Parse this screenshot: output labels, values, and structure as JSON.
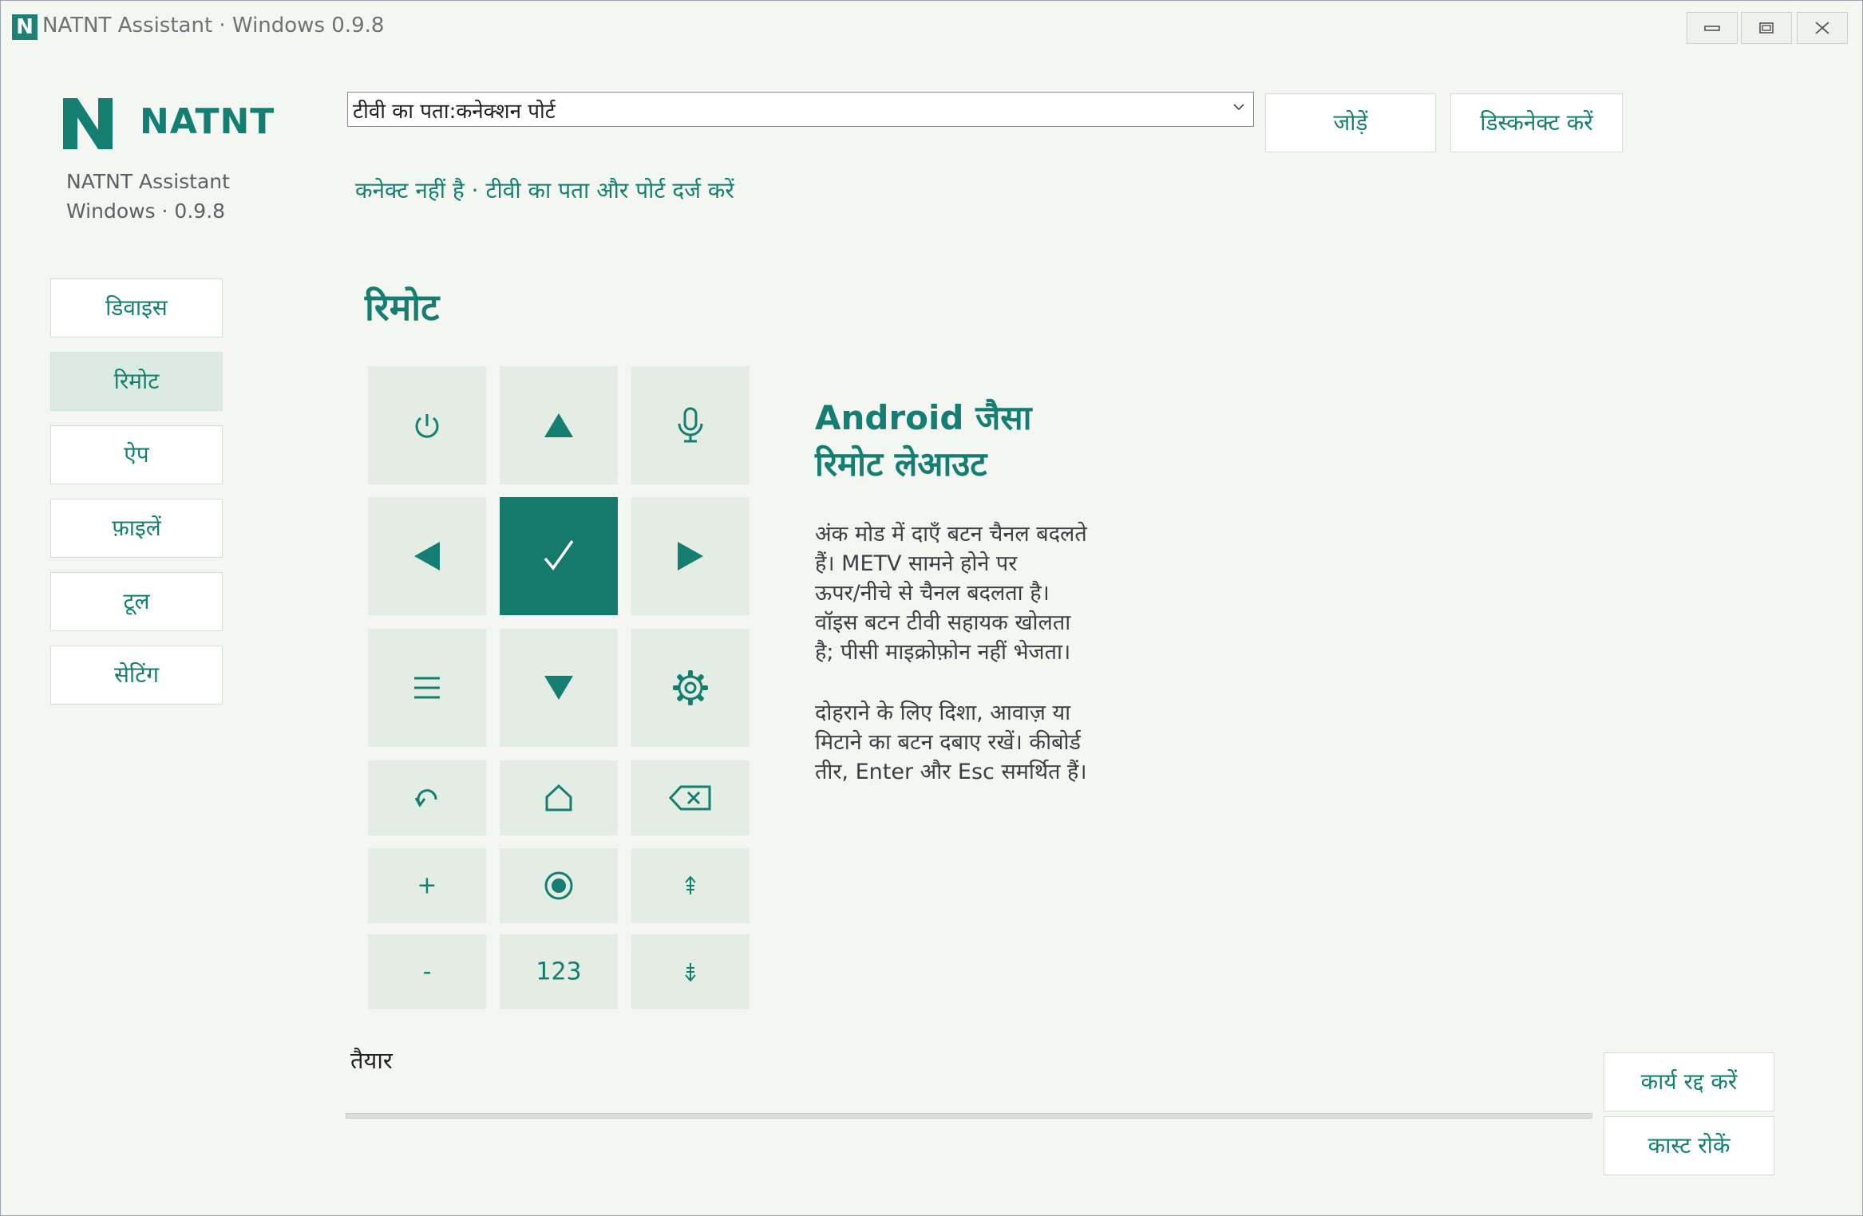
{
  "window": {
    "title": "NATNT Assistant · Windows 0.9.8",
    "app_icon_letter": "N"
  },
  "sidebar": {
    "brand": "NATNT",
    "app_name": "NATNT Assistant",
    "version": "Windows · 0.9.8",
    "items": [
      {
        "label": "डिवाइस",
        "active": false
      },
      {
        "label": "रिमोट",
        "active": true
      },
      {
        "label": "ऐप",
        "active": false
      },
      {
        "label": "फ़ाइलें",
        "active": false
      },
      {
        "label": "टूल",
        "active": false
      },
      {
        "label": "सेटिंग",
        "active": false
      }
    ]
  },
  "connection": {
    "address_value": "टीवी का पता:कनेक्शन पोर्ट",
    "connect_label": "जोड़ें",
    "disconnect_label": "डिस्कनेक्ट करें",
    "status": "कनेक्ट नहीं है · टीवी का पता और पोर्ट दर्ज करें"
  },
  "remote": {
    "title": "रिमोट",
    "keys": [
      {
        "icon": "power-icon"
      },
      {
        "icon": "arrow-up-icon"
      },
      {
        "icon": "microphone-icon"
      },
      {
        "icon": "arrow-left-icon"
      },
      {
        "icon": "ok-check-icon"
      },
      {
        "icon": "arrow-right-icon"
      },
      {
        "icon": "menu-icon"
      },
      {
        "icon": "arrow-down-icon"
      },
      {
        "icon": "settings-gear-icon"
      },
      {
        "icon": "back-icon"
      },
      {
        "icon": "home-icon"
      },
      {
        "icon": "backspace-icon"
      },
      {
        "label": "+"
      },
      {
        "icon": "record-icon"
      },
      {
        "icon": "channel-up-icon"
      },
      {
        "label": "-"
      },
      {
        "label": "123"
      },
      {
        "icon": "channel-down-icon"
      }
    ],
    "info_title_lines": [
      "Android जैसा",
      "रिमोट लेआउट"
    ],
    "info_para1_lines": [
      "अंक मोड में दाएँ बटन चैनल बदलते",
      "हैं। METV सामने होने पर",
      "ऊपर/नीचे से चैनल बदलता है।",
      "वॉइस बटन टीवी सहायक खोलता",
      "है; पीसी माइक्रोफ़ोन नहीं भेजता।"
    ],
    "info_para2_lines": [
      "दोहराने के लिए दिशा, आवाज़ या",
      "मिटाने का बटन दबाए रखें। कीबोर्ड",
      "तीर, Enter और Esc समर्थित हैं।"
    ]
  },
  "footer": {
    "status": "तैयार",
    "progress": 0,
    "cancel_label": "कार्य रद्द करें",
    "stop_cast_label": "कास्ट रोकें"
  },
  "colors": {
    "accent": "#157a6b",
    "key_bg": "#e3ede3",
    "window_bg": "#f3f6f1"
  }
}
